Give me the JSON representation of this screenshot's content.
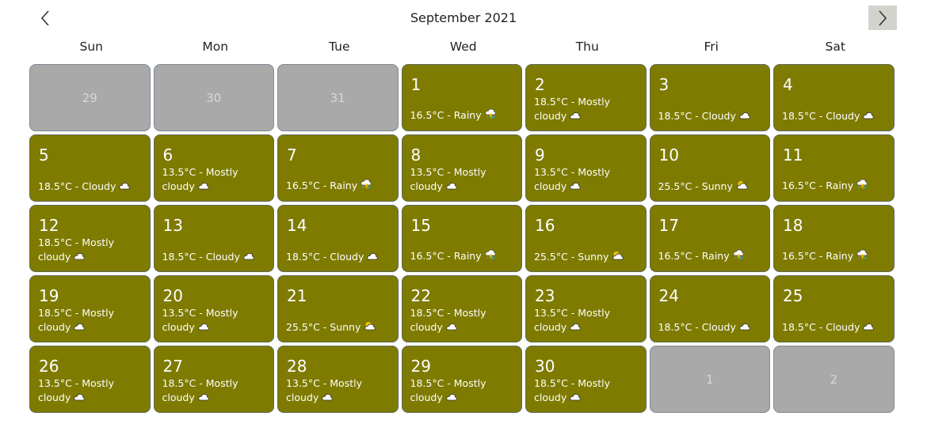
{
  "header": {
    "title": "September 2021",
    "prev_icon": "chevron-left-icon",
    "next_icon": "chevron-right-icon"
  },
  "weekdays": [
    "Sun",
    "Mon",
    "Tue",
    "Wed",
    "Thu",
    "Fri",
    "Sat"
  ],
  "colors": {
    "current_month_cell": "#7e7b00",
    "other_month_cell": "#a9a9a9",
    "next_button_bg": "#d3d3cd"
  },
  "days": [
    {
      "day": "29",
      "other": true
    },
    {
      "day": "30",
      "other": true
    },
    {
      "day": "31",
      "other": true
    },
    {
      "day": "1",
      "weather": "16.5°C - Rainy",
      "icon": "rain-icon"
    },
    {
      "day": "2",
      "weather": "18.5°C - Mostly cloudy",
      "icon": "cloud-icon"
    },
    {
      "day": "3",
      "weather": "18.5°C - Cloudy",
      "icon": "cloud-icon"
    },
    {
      "day": "4",
      "weather": "18.5°C - Cloudy",
      "icon": "cloud-icon"
    },
    {
      "day": "5",
      "weather": "18.5°C - Cloudy",
      "icon": "cloud-icon"
    },
    {
      "day": "6",
      "weather": "13.5°C - Mostly cloudy",
      "icon": "cloud-icon"
    },
    {
      "day": "7",
      "weather": "16.5°C - Rainy",
      "icon": "rain-icon"
    },
    {
      "day": "8",
      "weather": "13.5°C - Mostly cloudy",
      "icon": "cloud-icon"
    },
    {
      "day": "9",
      "weather": "13.5°C - Mostly cloudy",
      "icon": "cloud-icon"
    },
    {
      "day": "10",
      "weather": "25.5°C - Sunny",
      "icon": "sun-cloud-icon"
    },
    {
      "day": "11",
      "weather": "16.5°C - Rainy",
      "icon": "rain-icon"
    },
    {
      "day": "12",
      "weather": "18.5°C - Mostly cloudy",
      "icon": "cloud-icon"
    },
    {
      "day": "13",
      "weather": "18.5°C - Cloudy",
      "icon": "cloud-icon"
    },
    {
      "day": "14",
      "weather": "18.5°C - Cloudy",
      "icon": "cloud-icon"
    },
    {
      "day": "15",
      "weather": "16.5°C - Rainy",
      "icon": "rain-icon"
    },
    {
      "day": "16",
      "weather": "25.5°C - Sunny",
      "icon": "sun-cloud-icon"
    },
    {
      "day": "17",
      "weather": "16.5°C - Rainy",
      "icon": "rain-icon"
    },
    {
      "day": "18",
      "weather": "16.5°C - Rainy",
      "icon": "rain-icon"
    },
    {
      "day": "19",
      "weather": "18.5°C - Mostly cloudy",
      "icon": "cloud-icon"
    },
    {
      "day": "20",
      "weather": "13.5°C - Mostly cloudy",
      "icon": "cloud-icon"
    },
    {
      "day": "21",
      "weather": "25.5°C - Sunny",
      "icon": "sun-cloud-icon"
    },
    {
      "day": "22",
      "weather": "18.5°C - Mostly cloudy",
      "icon": "cloud-icon"
    },
    {
      "day": "23",
      "weather": "13.5°C - Mostly cloudy",
      "icon": "cloud-icon"
    },
    {
      "day": "24",
      "weather": "18.5°C - Cloudy",
      "icon": "cloud-icon"
    },
    {
      "day": "25",
      "weather": "18.5°C - Cloudy",
      "icon": "cloud-icon"
    },
    {
      "day": "26",
      "weather": "13.5°C - Mostly cloudy",
      "icon": "cloud-icon"
    },
    {
      "day": "27",
      "weather": "18.5°C - Mostly cloudy",
      "icon": "cloud-icon"
    },
    {
      "day": "28",
      "weather": "13.5°C - Mostly cloudy",
      "icon": "cloud-icon"
    },
    {
      "day": "29",
      "weather": "18.5°C - Mostly cloudy",
      "icon": "cloud-icon"
    },
    {
      "day": "30",
      "weather": "18.5°C - Mostly cloudy",
      "icon": "cloud-icon"
    },
    {
      "day": "1",
      "other": true
    },
    {
      "day": "2",
      "other": true
    }
  ]
}
